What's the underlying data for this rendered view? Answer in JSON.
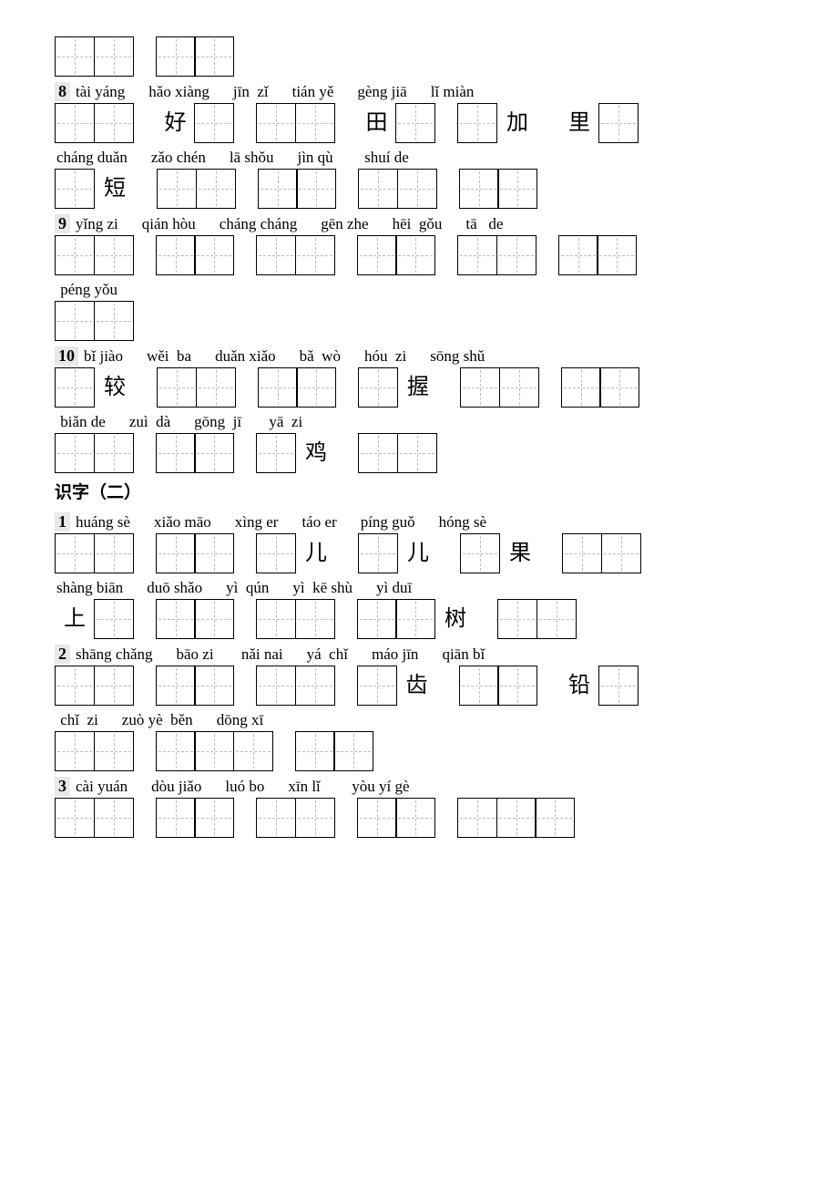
{
  "rows": [
    {
      "type": "cells",
      "groups": [
        {
          "items": [
            {
              "t": "box"
            },
            {
              "t": "box"
            }
          ]
        },
        {
          "items": [
            {
              "t": "box"
            },
            {
              "t": "box"
            }
          ]
        }
      ]
    },
    {
      "type": "pinyin",
      "num": "8",
      "groups": [
        {
          "p": "tài yáng"
        },
        {
          "p": "hǎo xiàng"
        },
        {
          "p": "jīn  zǐ"
        },
        {
          "p": "tián yě"
        },
        {
          "p": "gèng jiā"
        },
        {
          "p": "lǐ miàn"
        }
      ]
    },
    {
      "type": "cells",
      "groups": [
        {
          "items": [
            {
              "t": "box"
            },
            {
              "t": "box"
            }
          ]
        },
        {
          "items": [
            {
              "t": "han",
              "v": "好"
            },
            {
              "t": "box"
            }
          ]
        },
        {
          "items": [
            {
              "t": "box"
            },
            {
              "t": "box"
            }
          ]
        },
        {
          "items": [
            {
              "t": "han",
              "v": "田"
            },
            {
              "t": "box"
            }
          ]
        },
        {
          "items": [
            {
              "t": "box"
            },
            {
              "t": "han",
              "v": "加"
            }
          ]
        },
        {
          "items": [
            {
              "t": "han",
              "v": "里"
            },
            {
              "t": "box"
            }
          ]
        }
      ]
    },
    {
      "type": "pinyin",
      "groups": [
        {
          "p": "cháng duǎn"
        },
        {
          "p": "zǎo chén"
        },
        {
          "p": "lā shǒu"
        },
        {
          "p": "jìn qù"
        },
        {
          "p": "  shuí de"
        }
      ]
    },
    {
      "type": "cells",
      "groups": [
        {
          "items": [
            {
              "t": "box"
            },
            {
              "t": "han",
              "v": "短"
            }
          ]
        },
        {
          "items": [
            {
              "t": "box"
            },
            {
              "t": "box"
            }
          ]
        },
        {
          "items": [
            {
              "t": "box"
            },
            {
              "t": "box"
            }
          ]
        },
        {
          "items": [
            {
              "t": "box"
            },
            {
              "t": "box"
            }
          ]
        },
        {
          "items": [
            {
              "t": "box"
            },
            {
              "t": "box"
            }
          ]
        }
      ]
    },
    {
      "type": "pinyin",
      "num": "9",
      "groups": [
        {
          "p": "yǐng zi"
        },
        {
          "p": "qián hòu"
        },
        {
          "p": "cháng cháng"
        },
        {
          "p": "gēn zhe"
        },
        {
          "p": "hēi  gǒu"
        },
        {
          "p": "tā   de"
        }
      ]
    },
    {
      "type": "cells",
      "groups": [
        {
          "items": [
            {
              "t": "box"
            },
            {
              "t": "box"
            }
          ]
        },
        {
          "items": [
            {
              "t": "box"
            },
            {
              "t": "box"
            }
          ]
        },
        {
          "items": [
            {
              "t": "box"
            },
            {
              "t": "box"
            }
          ]
        },
        {
          "items": [
            {
              "t": "box"
            },
            {
              "t": "box"
            }
          ]
        },
        {
          "items": [
            {
              "t": "box"
            },
            {
              "t": "box"
            }
          ]
        },
        {
          "items": [
            {
              "t": "box"
            },
            {
              "t": "box"
            }
          ]
        }
      ]
    },
    {
      "type": "pinyin",
      "groups": [
        {
          "p": " péng yǒu"
        }
      ]
    },
    {
      "type": "cells",
      "groups": [
        {
          "items": [
            {
              "t": "box"
            },
            {
              "t": "box"
            }
          ]
        }
      ]
    },
    {
      "type": "pinyin",
      "num": "10",
      "groups": [
        {
          "p": "bǐ jiào"
        },
        {
          "p": "wěi  ba"
        },
        {
          "p": "duǎn xiǎo"
        },
        {
          "p": "bǎ  wò"
        },
        {
          "p": "hóu  zi"
        },
        {
          "p": "sōng shǔ"
        }
      ]
    },
    {
      "type": "cells",
      "groups": [
        {
          "items": [
            {
              "t": "box"
            },
            {
              "t": "han",
              "v": "较"
            }
          ]
        },
        {
          "items": [
            {
              "t": "box"
            },
            {
              "t": "box"
            }
          ]
        },
        {
          "items": [
            {
              "t": "box"
            },
            {
              "t": "box"
            }
          ]
        },
        {
          "items": [
            {
              "t": "box"
            },
            {
              "t": "han",
              "v": "握"
            }
          ]
        },
        {
          "items": [
            {
              "t": "box"
            },
            {
              "t": "box"
            }
          ]
        },
        {
          "items": [
            {
              "t": "box"
            },
            {
              "t": "box"
            }
          ]
        }
      ]
    },
    {
      "type": "pinyin",
      "groups": [
        {
          "p": " biǎn de"
        },
        {
          "p": "zuì  dà"
        },
        {
          "p": "gōng  jī"
        },
        {
          "p": " yā  zi"
        }
      ]
    },
    {
      "type": "cells",
      "groups": [
        {
          "items": [
            {
              "t": "box"
            },
            {
              "t": "box"
            }
          ]
        },
        {
          "items": [
            {
              "t": "box"
            },
            {
              "t": "box"
            }
          ]
        },
        {
          "items": [
            {
              "t": "box"
            },
            {
              "t": "han",
              "v": "鸡"
            }
          ]
        },
        {
          "items": [
            {
              "t": "box"
            },
            {
              "t": "box"
            }
          ]
        }
      ]
    },
    {
      "type": "heading",
      "text": "识字（二）"
    },
    {
      "type": "pinyin",
      "num": "1",
      "groups": [
        {
          "p": "huáng sè"
        },
        {
          "p": "xiǎo māo"
        },
        {
          "p": "xìng er"
        },
        {
          "p": "táo er"
        },
        {
          "p": "píng guǒ"
        },
        {
          "p": "hóng sè"
        }
      ]
    },
    {
      "type": "cells",
      "groups": [
        {
          "items": [
            {
              "t": "box"
            },
            {
              "t": "box"
            }
          ]
        },
        {
          "items": [
            {
              "t": "box"
            },
            {
              "t": "box"
            }
          ]
        },
        {
          "items": [
            {
              "t": "box"
            },
            {
              "t": "han",
              "v": "儿"
            }
          ]
        },
        {
          "items": [
            {
              "t": "box"
            },
            {
              "t": "han",
              "v": "儿"
            }
          ]
        },
        {
          "items": [
            {
              "t": "box"
            },
            {
              "t": "han",
              "v": "果"
            }
          ]
        },
        {
          "items": [
            {
              "t": "box"
            },
            {
              "t": "box"
            }
          ]
        }
      ]
    },
    {
      "type": "pinyin",
      "groups": [
        {
          "p": "shàng biān"
        },
        {
          "p": "duō shǎo"
        },
        {
          "p": "yì  qún"
        },
        {
          "p": "yì  kē shù"
        },
        {
          "p": "yì duī"
        }
      ]
    },
    {
      "type": "cells",
      "groups": [
        {
          "items": [
            {
              "t": "han",
              "v": "上"
            },
            {
              "t": "box"
            }
          ]
        },
        {
          "items": [
            {
              "t": "box"
            },
            {
              "t": "box"
            }
          ]
        },
        {
          "items": [
            {
              "t": "box"
            },
            {
              "t": "box"
            }
          ]
        },
        {
          "items": [
            {
              "t": "box"
            },
            {
              "t": "box"
            },
            {
              "t": "han",
              "v": "树"
            }
          ]
        },
        {
          "items": [
            {
              "t": "box"
            },
            {
              "t": "box"
            }
          ]
        }
      ]
    },
    {
      "type": "pinyin",
      "num": "2",
      "groups": [
        {
          "p": "shāng chǎng"
        },
        {
          "p": "bāo zi"
        },
        {
          "p": " nǎi nai"
        },
        {
          "p": "yá  chǐ"
        },
        {
          "p": "máo jīn"
        },
        {
          "p": "qiān bǐ"
        }
      ]
    },
    {
      "type": "cells",
      "groups": [
        {
          "items": [
            {
              "t": "box"
            },
            {
              "t": "box"
            }
          ]
        },
        {
          "items": [
            {
              "t": "box"
            },
            {
              "t": "box"
            }
          ]
        },
        {
          "items": [
            {
              "t": "box"
            },
            {
              "t": "box"
            }
          ]
        },
        {
          "items": [
            {
              "t": "box"
            },
            {
              "t": "han",
              "v": "齿"
            }
          ]
        },
        {
          "items": [
            {
              "t": "box"
            },
            {
              "t": "box"
            }
          ]
        },
        {
          "items": [
            {
              "t": "han",
              "v": "铅"
            },
            {
              "t": "box"
            }
          ]
        }
      ]
    },
    {
      "type": "pinyin",
      "groups": [
        {
          "p": " chǐ  zi"
        },
        {
          "p": "zuò yè  běn"
        },
        {
          "p": "dōng xī"
        }
      ]
    },
    {
      "type": "cells",
      "groups": [
        {
          "items": [
            {
              "t": "box"
            },
            {
              "t": "box"
            }
          ]
        },
        {
          "items": [
            {
              "t": "box"
            },
            {
              "t": "box"
            },
            {
              "t": "box"
            }
          ]
        },
        {
          "items": [
            {
              "t": "box"
            },
            {
              "t": "box"
            }
          ]
        }
      ]
    },
    {
      "type": "pinyin",
      "num": "3",
      "groups": [
        {
          "p": "cài yuán"
        },
        {
          "p": "dòu jiǎo"
        },
        {
          "p": "luó bo"
        },
        {
          "p": "xīn lǐ"
        },
        {
          "p": "  yòu yí gè"
        }
      ]
    },
    {
      "type": "cells",
      "groups": [
        {
          "items": [
            {
              "t": "box"
            },
            {
              "t": "box"
            }
          ]
        },
        {
          "items": [
            {
              "t": "box"
            },
            {
              "t": "box"
            }
          ]
        },
        {
          "items": [
            {
              "t": "box"
            },
            {
              "t": "box"
            }
          ]
        },
        {
          "items": [
            {
              "t": "box"
            },
            {
              "t": "box"
            }
          ]
        },
        {
          "items": [
            {
              "t": "box"
            },
            {
              "t": "box"
            },
            {
              "t": "box"
            }
          ]
        }
      ]
    }
  ]
}
